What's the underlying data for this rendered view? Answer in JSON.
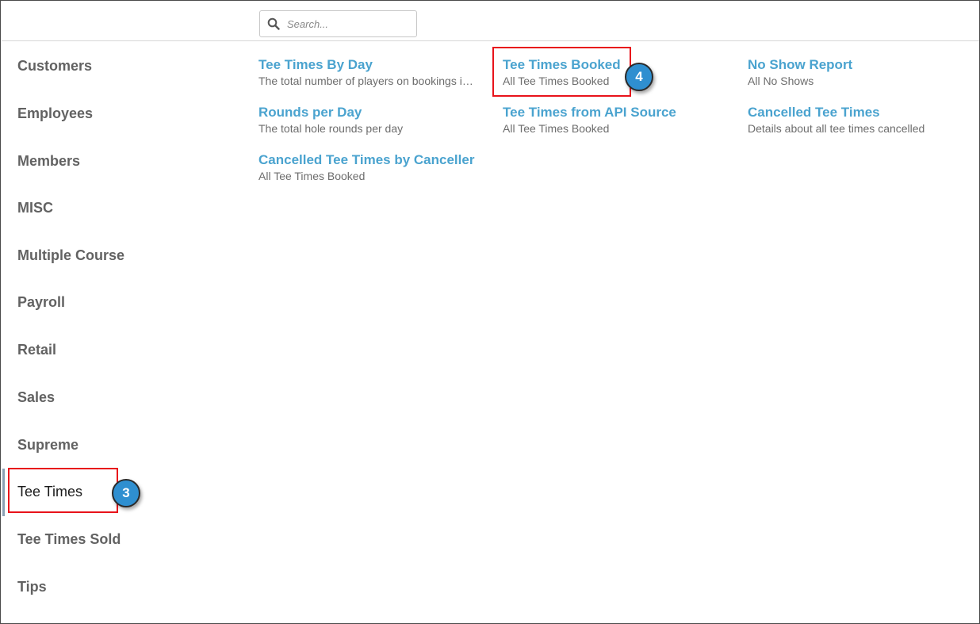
{
  "search": {
    "placeholder": "Search..."
  },
  "sidebar": {
    "items": [
      {
        "label": "Customers"
      },
      {
        "label": "Employees"
      },
      {
        "label": "Members"
      },
      {
        "label": "MISC"
      },
      {
        "label": "Multiple Course"
      },
      {
        "label": "Payroll"
      },
      {
        "label": "Retail"
      },
      {
        "label": "Sales"
      },
      {
        "label": "Supreme"
      },
      {
        "label": "Tee Times"
      },
      {
        "label": "Tee Times Sold"
      },
      {
        "label": "Tips"
      }
    ],
    "active_item": "Tee Times"
  },
  "reports": [
    {
      "title": "Tee Times By Day",
      "description": "The total number of players on bookings in a given day"
    },
    {
      "title": "Tee Times Booked",
      "description": "All Tee Times Booked"
    },
    {
      "title": "No Show Report",
      "description": "All No Shows"
    },
    {
      "title": "Rounds per Day",
      "description": "The total hole rounds per day"
    },
    {
      "title": "Tee Times from API Source",
      "description": "All Tee Times Booked"
    },
    {
      "title": "Cancelled Tee Times",
      "description": "Details about all tee times cancelled"
    },
    {
      "title": "Cancelled Tee Times by Canceller",
      "description": "All Tee Times Booked"
    }
  ],
  "annotations": {
    "step_sidebar": "3",
    "step_report": "4",
    "highlight_color": "#e8131b",
    "badge_color": "#2f8fd0"
  },
  "colors": {
    "link": "#4aa3cf",
    "sidebar_text": "#626262",
    "description_text": "#6d6d6d"
  }
}
